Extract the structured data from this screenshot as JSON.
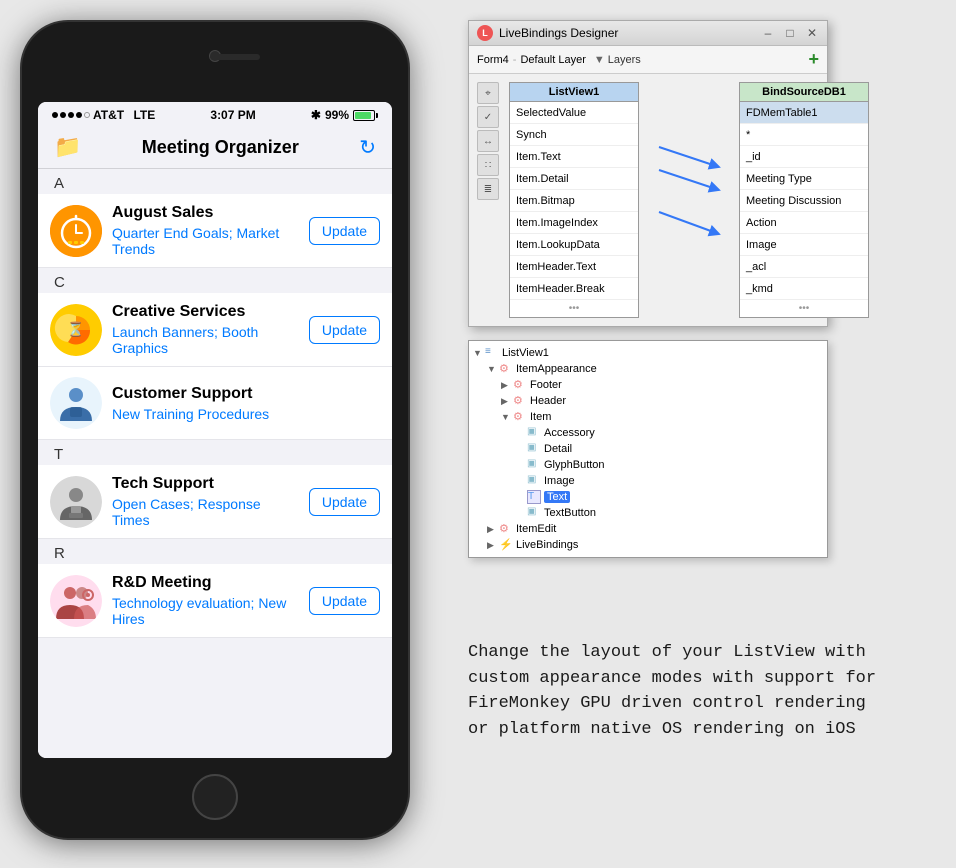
{
  "phone": {
    "status": {
      "carrier": "AT&T",
      "network": "LTE",
      "time": "3:07 PM",
      "battery": "99%"
    },
    "nav": {
      "title": "Meeting Organizer",
      "folder_icon": "📁",
      "refresh_icon": "↻"
    },
    "sections": [
      {
        "letter": "A",
        "items": [
          {
            "id": "august-sales",
            "title": "August Sales",
            "detail": "Quarter End Goals; Market Trends",
            "icon_type": "stopwatch",
            "has_update": true,
            "update_label": "Update"
          }
        ]
      },
      {
        "letter": "C",
        "items": [
          {
            "id": "creative-services",
            "title": "Creative Services",
            "detail": "Launch Banners; Booth Graphics",
            "icon_type": "chart",
            "has_update": true,
            "update_label": "Update"
          },
          {
            "id": "customer-support",
            "title": "Customer Support",
            "detail": "New Training Procedures",
            "icon_type": "support",
            "has_update": false,
            "update_label": ""
          }
        ]
      },
      {
        "letter": "T",
        "items": [
          {
            "id": "tech-support",
            "title": "Tech Support",
            "detail": "Open Cases; Response Times",
            "icon_type": "tech",
            "has_update": true,
            "update_label": "Update"
          }
        ]
      },
      {
        "letter": "R",
        "items": [
          {
            "id": "rd-meeting",
            "title": "R&D Meeting",
            "detail": "Technology evaluation; New Hires",
            "icon_type": "rd",
            "has_update": true,
            "update_label": "Update"
          }
        ]
      }
    ]
  },
  "livebindings": {
    "window_title": "LiveBindings Designer",
    "form_label": "Form4",
    "layer_label": "Default Layer",
    "layers_btn": "Layers",
    "add_btn": "+",
    "listview_title": "ListView1",
    "bindsource_title": "BindSourceDB1",
    "listview_fields": [
      "SelectedValue",
      "Synch",
      "Item.Text",
      "Item.Detail",
      "Item.Bitmap",
      "Item.ImageIndex",
      "Item.LookupData",
      "ItemHeader.Text",
      "ItemHeader.Break"
    ],
    "bindsource_fields": [
      "FDMemTable1",
      "*",
      "_id",
      "Meeting Type",
      "Meeting Discussion",
      "Action",
      "Image",
      "_acl",
      "_kmd"
    ],
    "connected_pairs": [
      {
        "from": "Item.Text",
        "to": "Meeting Type"
      },
      {
        "from": "Item.Detail",
        "to": "Meeting Discussion"
      },
      {
        "from": "Item.ImageIndex",
        "to": "Image"
      }
    ]
  },
  "tree": {
    "nodes": [
      {
        "label": "ListView1",
        "indent": 0,
        "expand": "▼",
        "icon": "list"
      },
      {
        "label": "ItemAppearance",
        "indent": 1,
        "expand": "▼",
        "icon": "item"
      },
      {
        "label": "Footer",
        "indent": 2,
        "expand": "▶",
        "icon": "item"
      },
      {
        "label": "Header",
        "indent": 2,
        "expand": "▶",
        "icon": "item"
      },
      {
        "label": "Item",
        "indent": 2,
        "expand": "▼",
        "icon": "item"
      },
      {
        "label": "Accessory",
        "indent": 3,
        "expand": "",
        "icon": "field"
      },
      {
        "label": "Detail",
        "indent": 3,
        "expand": "",
        "icon": "field"
      },
      {
        "label": "GlyphButton",
        "indent": 3,
        "expand": "",
        "icon": "field"
      },
      {
        "label": "Image",
        "indent": 3,
        "expand": "",
        "icon": "field"
      },
      {
        "label": "Text",
        "indent": 3,
        "expand": "",
        "icon": "field",
        "selected": true
      },
      {
        "label": "TextButton",
        "indent": 3,
        "expand": "",
        "icon": "field"
      },
      {
        "label": "ItemEdit",
        "indent": 1,
        "expand": "▶",
        "icon": "item"
      },
      {
        "label": "LiveBindings",
        "indent": 1,
        "expand": "▶",
        "icon": "binding"
      }
    ]
  },
  "description": {
    "line1": "Change the layout of your ListView with",
    "line2": "custom appearance modes with support for",
    "line3": "FireMonkey GPU driven control rendering",
    "line4": "or platform native OS rendering on iOS"
  }
}
